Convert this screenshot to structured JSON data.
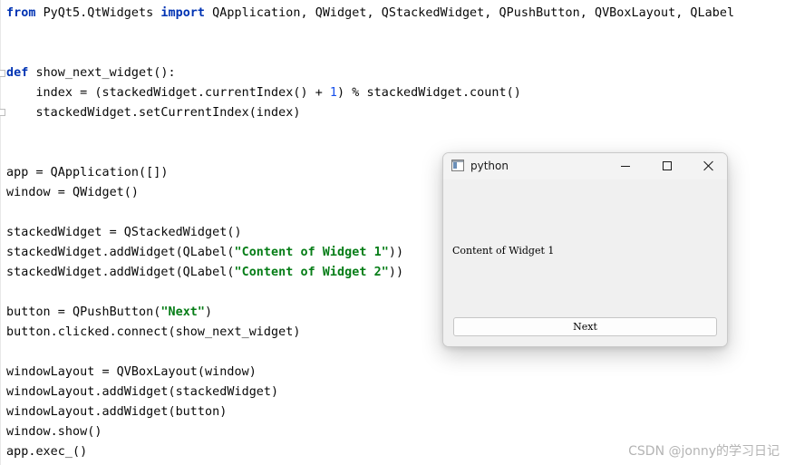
{
  "editor": {
    "lines": [
      [
        {
          "t": "from",
          "c": "kw"
        },
        {
          "t": " PyQt5.QtWidgets "
        },
        {
          "t": "import",
          "c": "kw"
        },
        {
          "t": " QApplication, QWidget, QStackedWidget, QPushButton, QVBoxLayout, QLabel"
        }
      ],
      [],
      [],
      [
        {
          "t": "def",
          "c": "kw"
        },
        {
          "t": " show_next_widget():"
        }
      ],
      [
        {
          "t": "    index = (stackedWidget.currentIndex() + "
        },
        {
          "t": "1",
          "c": "num"
        },
        {
          "t": ") % stackedWidget.count()"
        }
      ],
      [
        {
          "t": "    stackedWidget.setCurrentIndex(index)"
        }
      ],
      [],
      [],
      [
        {
          "t": "app = QApplication([])"
        }
      ],
      [
        {
          "t": "window = QWidget()"
        }
      ],
      [],
      [
        {
          "t": "stackedWidget = QStackedWidget()"
        }
      ],
      [
        {
          "t": "stackedWidget.addWidget(QLabel("
        },
        {
          "t": "\"Content of Widget 1\"",
          "c": "str"
        },
        {
          "t": "))"
        }
      ],
      [
        {
          "t": "stackedWidget.addWidget(QLabel("
        },
        {
          "t": "\"Content of Widget 2\"",
          "c": "str"
        },
        {
          "t": "))"
        }
      ],
      [],
      [
        {
          "t": "button = QPushButton("
        },
        {
          "t": "\"Next\"",
          "c": "str"
        },
        {
          "t": ")"
        }
      ],
      [
        {
          "t": "button.clicked.connect(show_next_widget)"
        }
      ],
      [],
      [
        {
          "t": "windowLayout = QVBoxLayout(window)"
        }
      ],
      [
        {
          "t": "windowLayout.addWidget(stackedWidget)"
        }
      ],
      [
        {
          "t": "windowLayout.addWidget(button)"
        }
      ],
      [
        {
          "t": "window.show()"
        }
      ],
      [
        {
          "t": "app.exec_()"
        }
      ]
    ]
  },
  "watermark": "CSDN @jonny的学习日记",
  "window": {
    "title": "python",
    "icon": "python-app-icon",
    "controls": [
      "minimize-icon",
      "maximize-icon",
      "close-icon"
    ],
    "label_text": "Content of Widget 1",
    "button_label": "Next"
  },
  "colors": {
    "keyword": "#0033b3",
    "string": "#067d17",
    "number": "#1750eb",
    "text": "#080808",
    "window_bg": "#f0f0f0"
  }
}
